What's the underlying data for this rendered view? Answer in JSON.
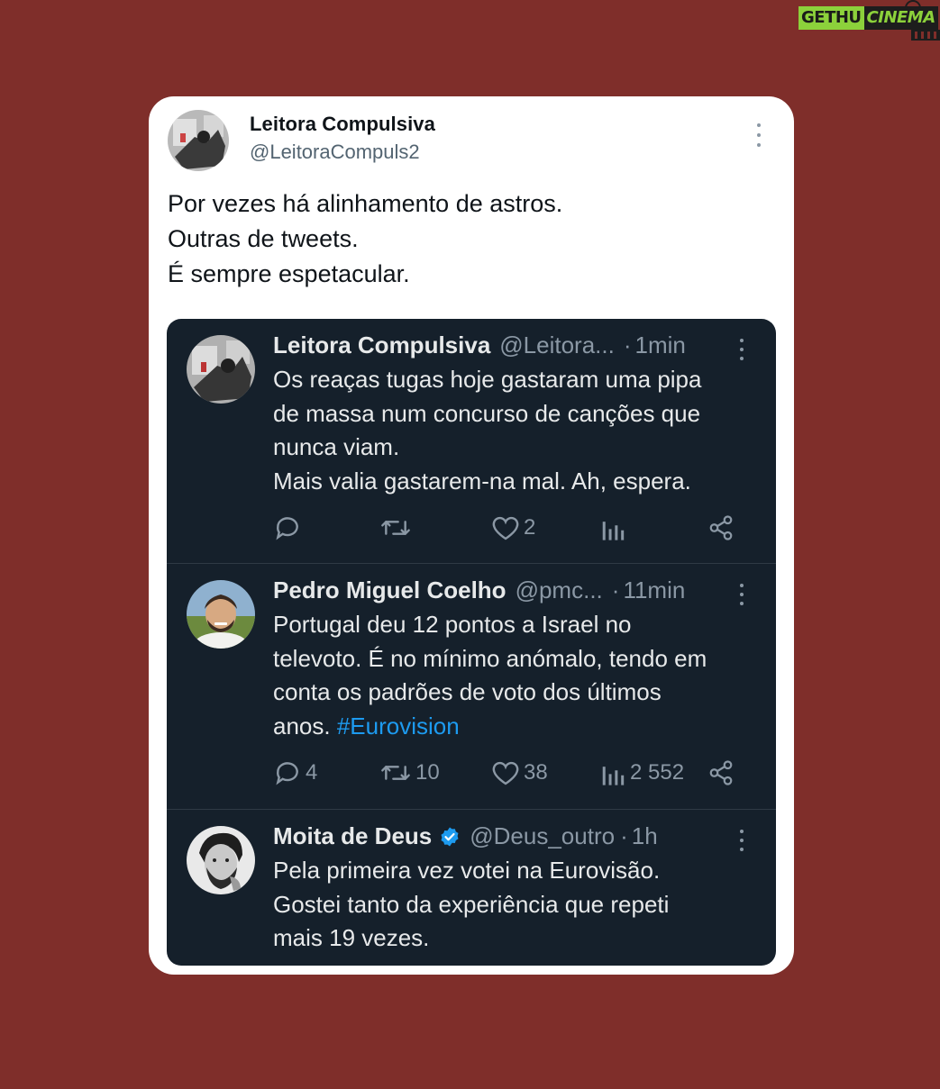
{
  "watermark": {
    "part1": "GETHU",
    "part2": "CINEMA"
  },
  "post": {
    "author_name": "Leitora Compulsiva",
    "author_handle": "@LeitoraCompuls2",
    "lines": [
      "Por vezes há alinhamento de astros.",
      "Outras de tweets.",
      "É sempre espetacular."
    ]
  },
  "tweets": [
    {
      "name": "Leitora Compulsiva",
      "handle": "@Leitora...",
      "separator": "·",
      "time": "1min",
      "verified": false,
      "lines": [
        "Os reaças tugas hoje gastaram uma pipa",
        "de massa num concurso de canções que",
        "nunca viam.",
        "Mais valia gastarem-na mal. Ah, espera."
      ],
      "replies": "",
      "retweets": "",
      "likes": "2",
      "views": ""
    },
    {
      "name": "Pedro Miguel Coelho",
      "handle": "@pmc...",
      "separator": "·",
      "time": "11min",
      "verified": false,
      "lines": [
        "Portugal deu 12 pontos a Israel no",
        "televoto. É no mínimo anómalo, tendo em",
        "conta os padrões de voto dos últimos"
      ],
      "last_line_text": "anos. ",
      "hashtag": "#Eurovision",
      "replies": "4",
      "retweets": "10",
      "likes": "38",
      "views": "2 552"
    },
    {
      "name": "Moita de Deus",
      "handle": "@Deus_outro",
      "separator": "·",
      "time": "1h",
      "verified": true,
      "lines": [
        "Pela primeira vez votei na Eurovisão.",
        "Gostei tanto da experiência que repeti",
        "mais 19 vezes."
      ]
    }
  ],
  "colors": {
    "background": "#7f2e2a",
    "card": "#ffffff",
    "dark_panel": "#15202b",
    "hashtag": "#1d9bf0",
    "verified_badge": "#1d9bf0",
    "muted": "#8b98a5"
  },
  "icons": [
    "more-vertical-icon",
    "reply-icon",
    "retweet-icon",
    "like-icon",
    "views-icon",
    "share-icon",
    "verified-badge-icon"
  ]
}
